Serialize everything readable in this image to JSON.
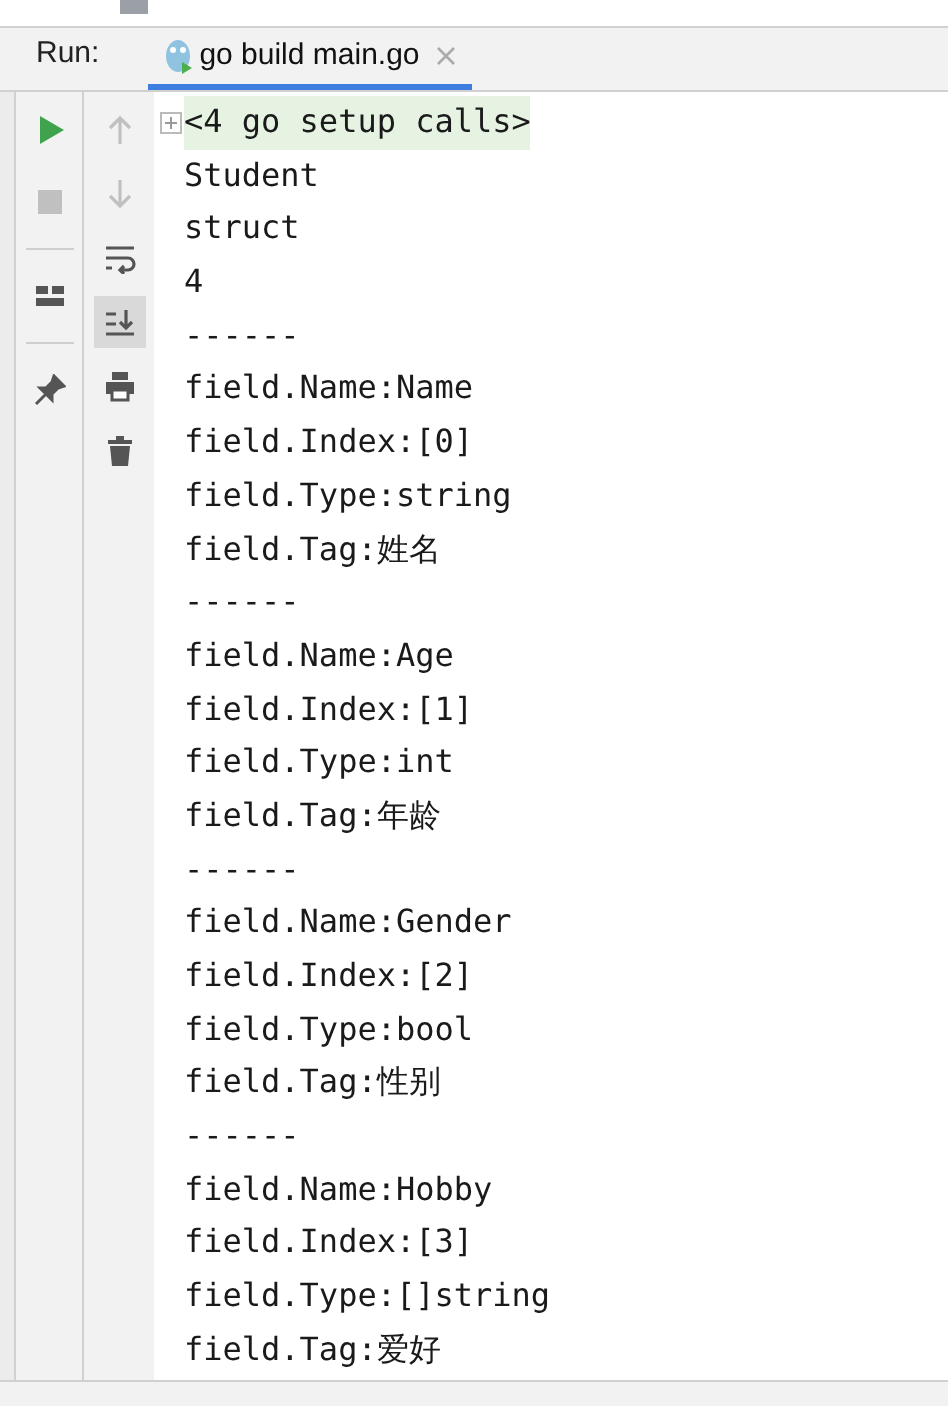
{
  "run_panel": {
    "label": "Run:",
    "tabs": [
      {
        "label": "go build main.go",
        "selected": true
      }
    ]
  },
  "toolbar": [
    {
      "kind": "run",
      "disabled": false
    },
    {
      "kind": "stop",
      "disabled": true
    },
    {
      "kind": "layout",
      "disabled": false
    },
    {
      "kind": "pin",
      "disabled": false
    }
  ],
  "console_toolbar": [
    {
      "kind": "up",
      "disabled": true,
      "selected": false
    },
    {
      "kind": "down",
      "disabled": true,
      "selected": false
    },
    {
      "kind": "wrap",
      "disabled": false,
      "selected": false
    },
    {
      "kind": "scroll",
      "disabled": false,
      "selected": true
    },
    {
      "kind": "print",
      "disabled": false,
      "selected": false
    },
    {
      "kind": "trash",
      "disabled": false,
      "selected": false
    }
  ],
  "console": [
    {
      "kind": "folded",
      "text": "<4 go setup calls>"
    },
    {
      "kind": "output",
      "text": "Student"
    },
    {
      "kind": "output",
      "text": "struct"
    },
    {
      "kind": "output",
      "text": "4"
    },
    {
      "kind": "output",
      "text": "------"
    },
    {
      "kind": "output",
      "text": "field.Name:Name"
    },
    {
      "kind": "output",
      "text": "field.Index:[0]"
    },
    {
      "kind": "output",
      "text": "field.Type:string"
    },
    {
      "kind": "output",
      "text": "field.Tag:姓名"
    },
    {
      "kind": "output",
      "text": "------"
    },
    {
      "kind": "output",
      "text": "field.Name:Age"
    },
    {
      "kind": "output",
      "text": "field.Index:[1]"
    },
    {
      "kind": "output",
      "text": "field.Type:int"
    },
    {
      "kind": "output",
      "text": "field.Tag:年龄"
    },
    {
      "kind": "output",
      "text": "------"
    },
    {
      "kind": "output",
      "text": "field.Name:Gender"
    },
    {
      "kind": "output",
      "text": "field.Index:[2]"
    },
    {
      "kind": "output",
      "text": "field.Type:bool"
    },
    {
      "kind": "output",
      "text": "field.Tag:性别"
    },
    {
      "kind": "output",
      "text": "------"
    },
    {
      "kind": "output",
      "text": "field.Name:Hobby"
    },
    {
      "kind": "output",
      "text": "field.Index:[3]"
    },
    {
      "kind": "output",
      "text": "field.Type:[]string"
    },
    {
      "kind": "output",
      "text": "field.Tag:爱好"
    }
  ]
}
